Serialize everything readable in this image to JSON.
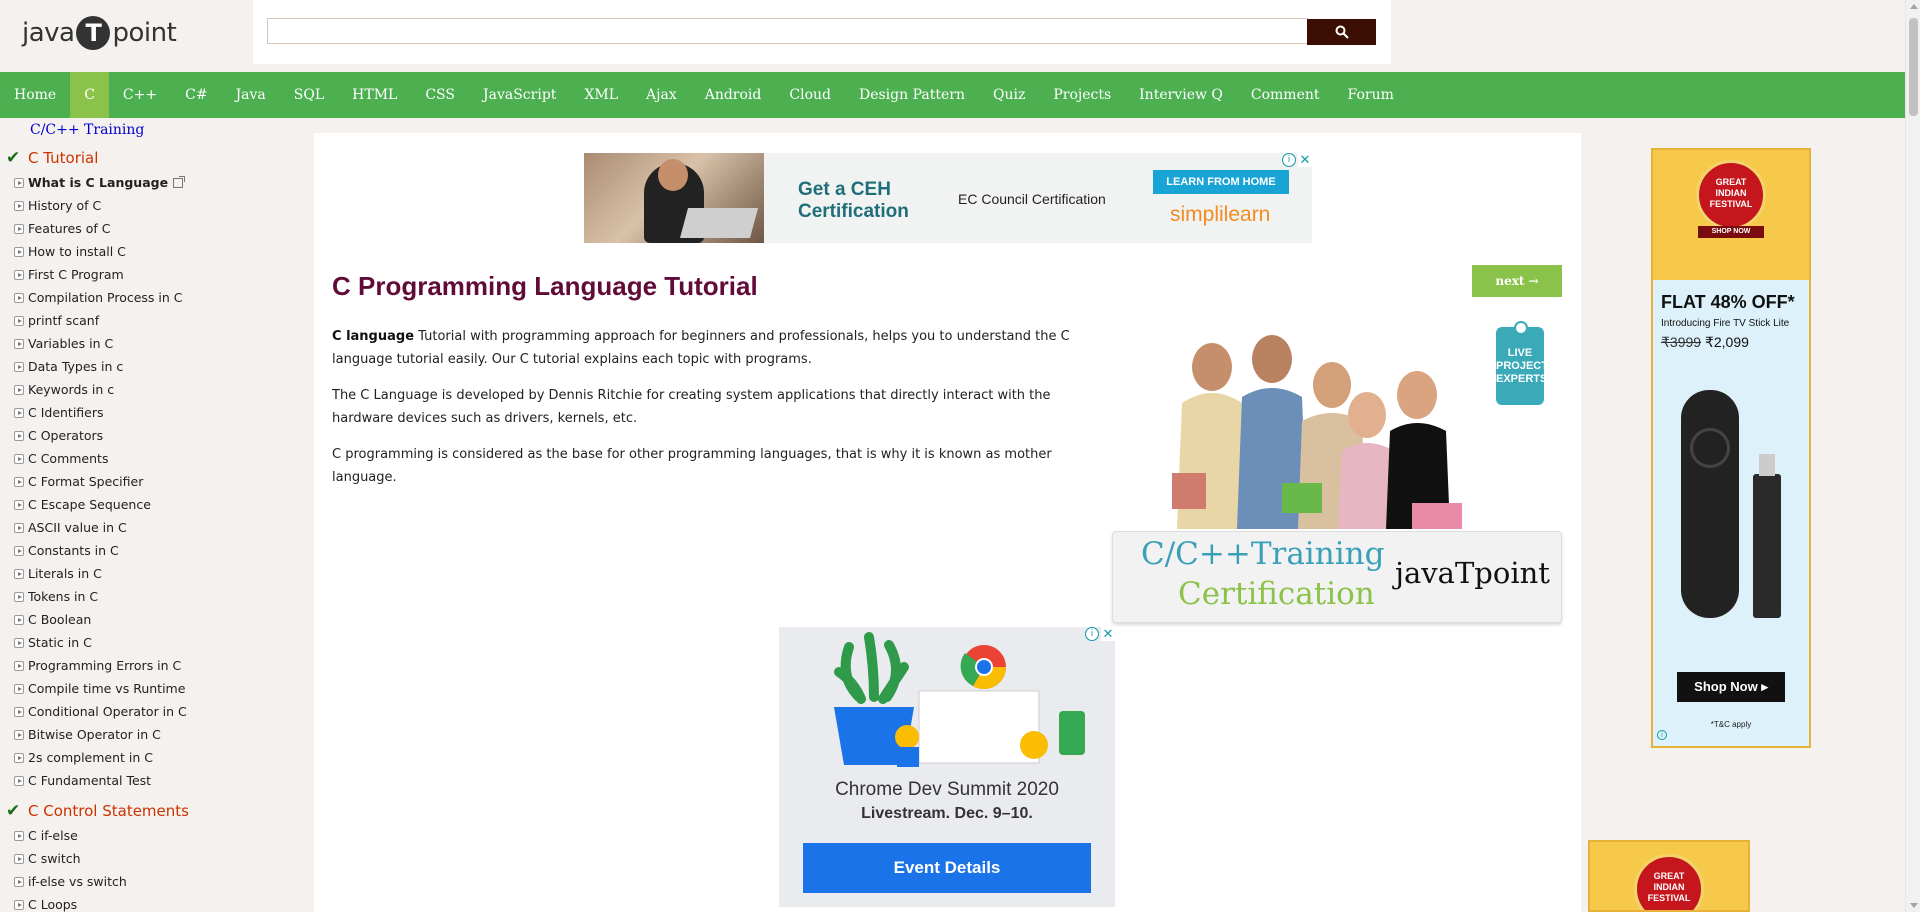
{
  "header": {
    "logo_left": "java",
    "logo_badge": "T",
    "logo_right": "point",
    "search_placeholder": "",
    "search_icon": "search-icon"
  },
  "nav": [
    {
      "label": "Home",
      "active": false
    },
    {
      "label": "C",
      "active": true
    },
    {
      "label": "C++",
      "active": false
    },
    {
      "label": "C#",
      "active": false
    },
    {
      "label": "Java",
      "active": false
    },
    {
      "label": "SQL",
      "active": false
    },
    {
      "label": "HTML",
      "active": false
    },
    {
      "label": "CSS",
      "active": false
    },
    {
      "label": "JavaScript",
      "active": false
    },
    {
      "label": "XML",
      "active": false
    },
    {
      "label": "Ajax",
      "active": false
    },
    {
      "label": "Android",
      "active": false
    },
    {
      "label": "Cloud",
      "active": false
    },
    {
      "label": "Design Pattern",
      "active": false
    },
    {
      "label": "Quiz",
      "active": false
    },
    {
      "label": "Projects",
      "active": false
    },
    {
      "label": "Interview Q",
      "active": false
    },
    {
      "label": "Comment",
      "active": false
    },
    {
      "label": "Forum",
      "active": false
    }
  ],
  "sidebar": {
    "training_link": "C/C++ Training",
    "section1": "C Tutorial",
    "section1_items": [
      "What is C Language",
      "History of C",
      "Features of C",
      "How to install C",
      "First C Program",
      "Compilation Process in C",
      "printf scanf",
      "Variables in C",
      "Data Types in c",
      "Keywords in c",
      "C Identifiers",
      "C Operators",
      "C Comments",
      "C Format Specifier",
      "C Escape Sequence",
      "ASCII value in C",
      "Constants in C",
      "Literals in C",
      "Tokens in C",
      "C Boolean",
      "Static in C",
      "Programming Errors in C",
      "Compile time vs Runtime",
      "Conditional Operator in C",
      "Bitwise Operator in C",
      "2s complement in C",
      "C Fundamental Test"
    ],
    "section2": "C Control Statements",
    "section2_items": [
      "C if-else",
      "C switch",
      "if-else vs switch",
      "C Loops"
    ]
  },
  "ad_top": {
    "headline_line1": "Get a CEH",
    "headline_line2": "Certification",
    "sub": "EC Council Certification",
    "cta": "LEARN FROM HOME",
    "brand": "simplilearn"
  },
  "main": {
    "title": "C Programming Language Tutorial",
    "next_label": "next →",
    "para1_bold": "C language",
    "para1_rest": " Tutorial with programming approach for beginners and professionals, helps you to understand the C language tutorial easily. Our C tutorial explains each topic with programs.",
    "para2": "The C Language is developed by Dennis Ritchie for creating system applications that directly interact with the hardware devices such as drivers, kernels, etc.",
    "para3": "C programming is considered as the base for other programming languages, that is why it is known as mother language."
  },
  "promo": {
    "badge_line1": "LIVE",
    "badge_line2": "PROJECT",
    "badge_line3": "EXPERTS",
    "line1": "C/C++Training",
    "line2": "Certification",
    "brand": "javaTpoint"
  },
  "ad_chrome": {
    "title": "Chrome Dev Summit 2020",
    "sub": "Livestream. Dec. 9–10.",
    "cta": "Event Details"
  },
  "ad_right": {
    "festival_line1": "GREAT",
    "festival_line2": "INDIAN",
    "festival_line3": "FESTIVAL",
    "shop_pill": "SHOP NOW",
    "flat": "FLAT 48% OFF*",
    "intro": "Introducing Fire TV Stick Lite",
    "price_old": "₹3999",
    "price_new": "₹2,099",
    "cta": "Shop Now ▸",
    "tc": "*T&C apply"
  }
}
